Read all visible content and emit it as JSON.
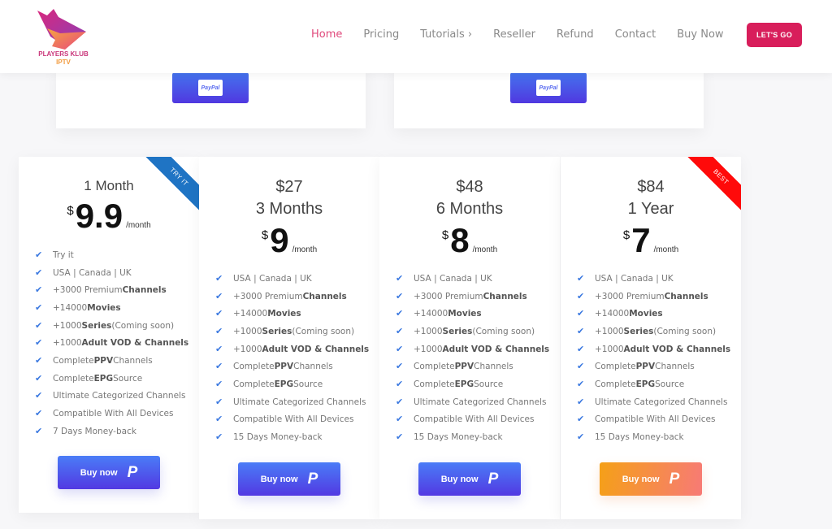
{
  "header": {
    "logo_title": "PLAYERS KLUB",
    "logo_subtitle": "IPTV",
    "nav": [
      "Home",
      "Pricing",
      "Tutorials ›",
      "Reseller",
      "Refund",
      "Contact",
      "Buy Now"
    ],
    "cta_label": "LET'S GO",
    "accent_color": "#d81e5b"
  },
  "top_cards": [
    {
      "button": "PayPal"
    },
    {
      "button": "PayPal"
    }
  ],
  "plans": [
    {
      "total": "",
      "title": "1 Month",
      "currency": "$",
      "price": "9.9",
      "per": "/month",
      "ribbon": "TRY IT",
      "ribbon_color": "#1f74c4",
      "features": [
        [
          "Try it",
          "",
          ""
        ],
        [
          "USA | Canada | UK",
          "",
          ""
        ],
        [
          "+3000 Premium ",
          "Channels",
          ""
        ],
        [
          "+14000 ",
          "Movies",
          ""
        ],
        [
          "+1000 ",
          "Series",
          "(Coming soon)"
        ],
        [
          "+1000 ",
          "Adult VOD & Channels",
          ""
        ],
        [
          "Complete ",
          "PPV",
          " Channels"
        ],
        [
          "Complete ",
          "EPG",
          " Source"
        ],
        [
          "Ultimate Categorized Channels",
          "",
          ""
        ],
        [
          "Compatible With All Devices",
          "",
          ""
        ],
        [
          "7 Days Money-back",
          "",
          ""
        ]
      ],
      "button": "Buy now"
    },
    {
      "total": "$27",
      "title": "3 Months",
      "currency": "$",
      "price": "9",
      "per": "/month",
      "ribbon": "",
      "features": [
        [
          "USA | Canada | UK",
          "",
          ""
        ],
        [
          "+3000 Premium ",
          "Channels",
          ""
        ],
        [
          "+14000 ",
          "Movies",
          ""
        ],
        [
          "+1000 ",
          "Series",
          "(Coming soon)"
        ],
        [
          "+1000 ",
          "Adult VOD & Channels",
          ""
        ],
        [
          "Complete ",
          "PPV",
          " Channels"
        ],
        [
          "Complete ",
          "EPG",
          " Source"
        ],
        [
          "Ultimate Categorized Channels",
          "",
          ""
        ],
        [
          "Compatible With All Devices",
          "",
          ""
        ],
        [
          "15 Days Money-back",
          "",
          ""
        ]
      ],
      "button": "Buy now"
    },
    {
      "total": "$48",
      "title": "6 Months",
      "currency": "$",
      "price": "8",
      "per": "/month",
      "ribbon": "",
      "features": [
        [
          "USA | Canada | UK",
          "",
          ""
        ],
        [
          "+3000 Premium ",
          "Channels",
          ""
        ],
        [
          "+14000 ",
          "Movies",
          ""
        ],
        [
          "+1000 ",
          "Series",
          "(Coming soon)"
        ],
        [
          "+1000 ",
          "Adult VOD & Channels",
          ""
        ],
        [
          "Complete ",
          "PPV",
          " Channels"
        ],
        [
          "Complete ",
          "EPG",
          " Source"
        ],
        [
          "Ultimate Categorized Channels",
          "",
          ""
        ],
        [
          "Compatible With All Devices",
          "",
          ""
        ],
        [
          "15 Days Money-back",
          "",
          ""
        ]
      ],
      "button": "Buy now"
    },
    {
      "total": "$84",
      "title": "1 Year",
      "currency": "$",
      "price": "7",
      "per": "/month",
      "ribbon": "BEST",
      "ribbon_color": "#ff0a0a",
      "features": [
        [
          "USA | Canada | UK",
          "",
          ""
        ],
        [
          "+3000 Premium ",
          "Channels",
          ""
        ],
        [
          "+14000 ",
          "Movies",
          ""
        ],
        [
          "+1000 ",
          "Series",
          "(Coming soon)"
        ],
        [
          "+1000 ",
          "Adult VOD & Channels",
          ""
        ],
        [
          "Complete ",
          "PPV",
          " Channels"
        ],
        [
          "Complete ",
          "EPG",
          " Source"
        ],
        [
          "Ultimate Categorized Channels",
          "",
          ""
        ],
        [
          "Compatible With All Devices",
          "",
          ""
        ],
        [
          "15 Days Money-back",
          "",
          ""
        ]
      ],
      "button": "Buy now"
    }
  ]
}
